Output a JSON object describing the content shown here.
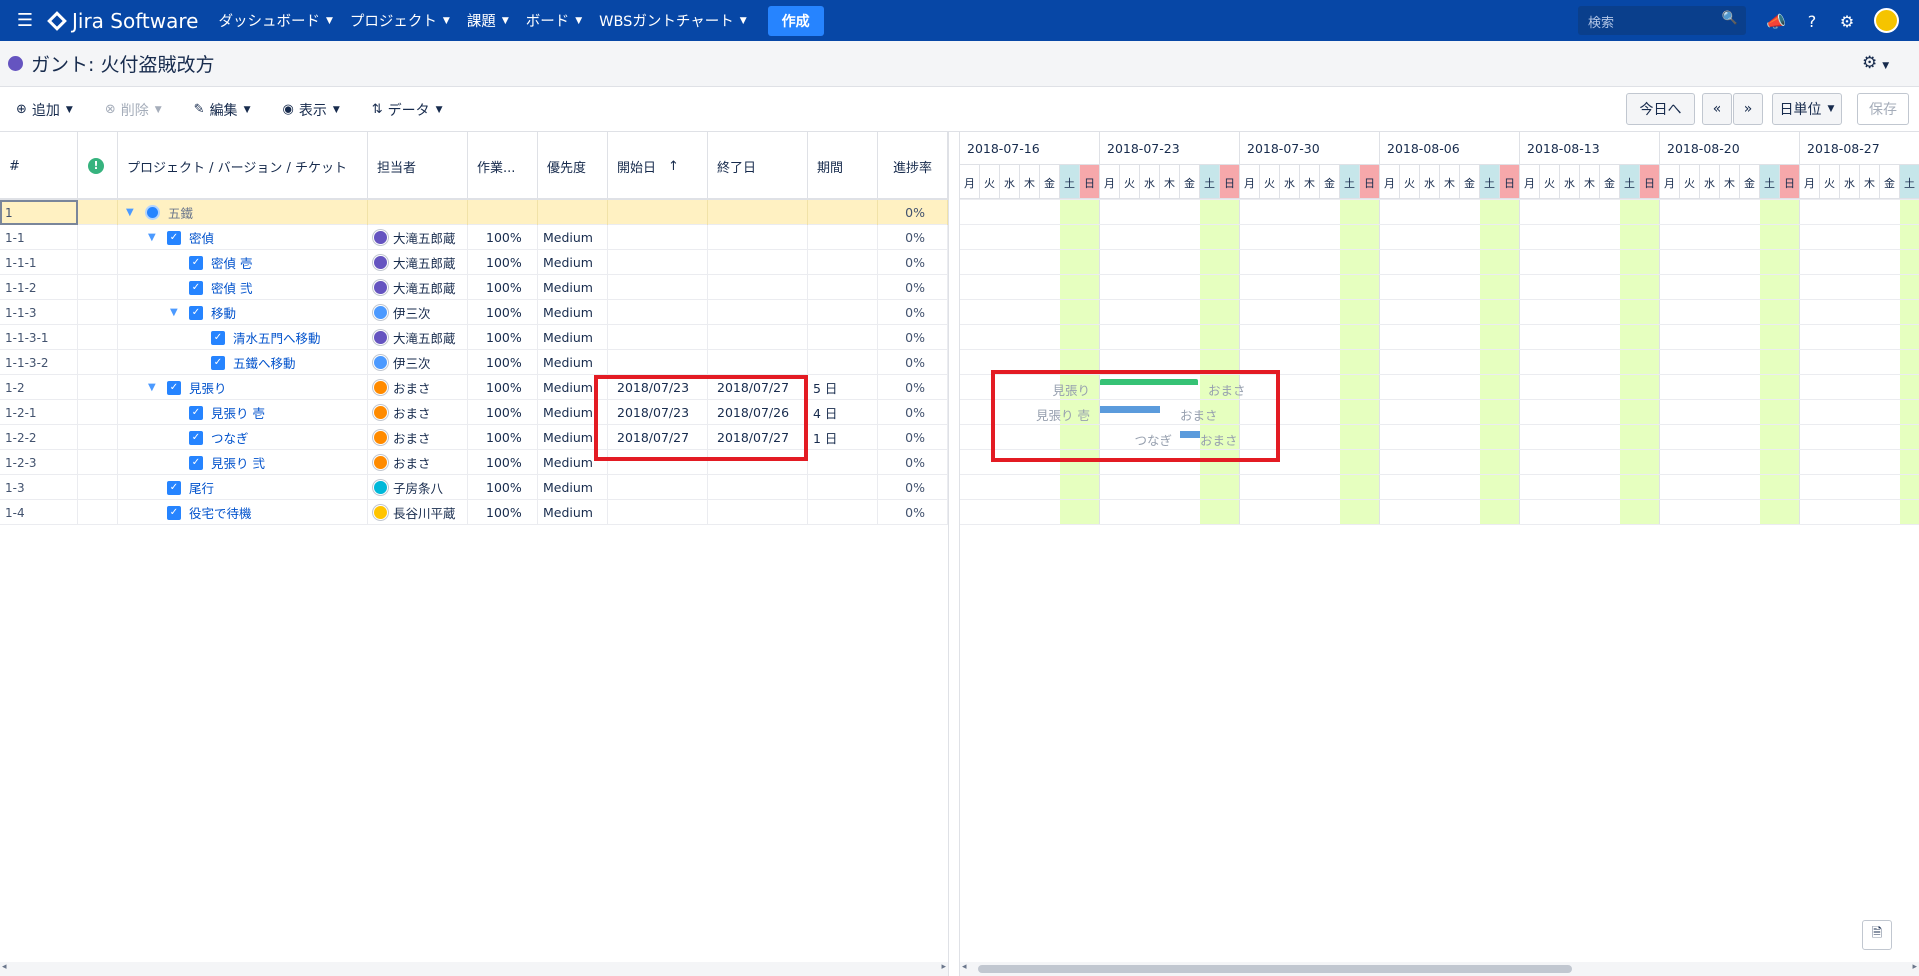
{
  "nav": {
    "logo": "Jira Software",
    "items": [
      {
        "label": "ダッシュボード"
      },
      {
        "label": "プロジェクト"
      },
      {
        "label": "課題"
      },
      {
        "label": "ボード"
      },
      {
        "label": "WBSガントチャート"
      }
    ],
    "create": "作成",
    "search_placeholder": "検索"
  },
  "page": {
    "title": "ガント: 火付盗賊改方"
  },
  "toolbar": {
    "add": "追加",
    "delete": "削除",
    "edit": "編集",
    "view": "表示",
    "data": "データ",
    "today": "今日へ",
    "prev": "«",
    "next": "»",
    "unit": "日単位",
    "save": "保存"
  },
  "grid": {
    "columns": {
      "num": "#",
      "name": "プロジェクト / バージョン / チケット",
      "assignee": "担当者",
      "work": "作業...",
      "priority": "優先度",
      "start": "開始日",
      "start_sort": "↑",
      "end": "終了日",
      "duration": "期間",
      "progress": "進捗率"
    },
    "rows": [
      {
        "id": "1",
        "name": "五鐵",
        "assignee": "",
        "work": "",
        "priority": "",
        "start": "",
        "end": "",
        "duration": "",
        "progress": "0%"
      },
      {
        "id": "1-1",
        "name": "密偵",
        "assignee": "大滝五郎蔵",
        "work": "100%",
        "priority": "Medium",
        "start": "",
        "end": "",
        "duration": "",
        "progress": "0%"
      },
      {
        "id": "1-1-1",
        "name": "密偵 壱",
        "assignee": "大滝五郎蔵",
        "work": "100%",
        "priority": "Medium",
        "start": "",
        "end": "",
        "duration": "",
        "progress": "0%"
      },
      {
        "id": "1-1-2",
        "name": "密偵 弐",
        "assignee": "大滝五郎蔵",
        "work": "100%",
        "priority": "Medium",
        "start": "",
        "end": "",
        "duration": "",
        "progress": "0%"
      },
      {
        "id": "1-1-3",
        "name": "移動",
        "assignee": "伊三次",
        "work": "100%",
        "priority": "Medium",
        "start": "",
        "end": "",
        "duration": "",
        "progress": "0%"
      },
      {
        "id": "1-1-3-1",
        "name": "清水五門へ移動",
        "assignee": "大滝五郎蔵",
        "work": "100%",
        "priority": "Medium",
        "start": "",
        "end": "",
        "duration": "",
        "progress": "0%"
      },
      {
        "id": "1-1-3-2",
        "name": "五鐵へ移動",
        "assignee": "伊三次",
        "work": "100%",
        "priority": "Medium",
        "start": "",
        "end": "",
        "duration": "",
        "progress": "0%"
      },
      {
        "id": "1-2",
        "name": "見張り",
        "assignee": "おまさ",
        "work": "100%",
        "priority": "Medium",
        "start": "2018/07/23",
        "end": "2018/07/27",
        "duration": "5 日",
        "progress": "0%"
      },
      {
        "id": "1-2-1",
        "name": "見張り 壱",
        "assignee": "おまさ",
        "work": "100%",
        "priority": "Medium",
        "start": "2018/07/23",
        "end": "2018/07/26",
        "duration": "4 日",
        "progress": "0%"
      },
      {
        "id": "1-2-2",
        "name": "つなぎ",
        "assignee": "おまさ",
        "work": "100%",
        "priority": "Medium",
        "start": "2018/07/27",
        "end": "2018/07/27",
        "duration": "1 日",
        "progress": "0%"
      },
      {
        "id": "1-2-3",
        "name": "見張り 弐",
        "assignee": "おまさ",
        "work": "100%",
        "priority": "Medium",
        "start": "",
        "end": "",
        "duration": "",
        "progress": "0%"
      },
      {
        "id": "1-3",
        "name": "尾行",
        "assignee": "子房条八",
        "work": "100%",
        "priority": "Medium",
        "start": "",
        "end": "",
        "duration": "",
        "progress": "0%"
      },
      {
        "id": "1-4",
        "name": "役宅で待機",
        "assignee": "長谷川平蔵",
        "work": "100%",
        "priority": "Medium",
        "start": "",
        "end": "",
        "duration": "",
        "progress": "0%"
      }
    ]
  },
  "gantt": {
    "weeks": [
      "2018-07-16",
      "2018-07-23",
      "2018-07-30",
      "2018-08-06",
      "2018-08-13",
      "2018-08-20",
      "2018-08-27"
    ],
    "days": [
      "月",
      "火",
      "水",
      "木",
      "金",
      "土",
      "日"
    ],
    "bars": [
      {
        "label_left": "見張り",
        "label_right": "おまさ"
      },
      {
        "label_left": "見張り 壱",
        "label_right": "おまさ"
      },
      {
        "label_left": "つなぎ",
        "label_right": "おまさ"
      }
    ]
  },
  "colors": {
    "nav_bg": "#0747a6",
    "accent": "#2684ff",
    "weekend": "#e6ffbf",
    "sat": "#c6e6ea",
    "sun": "#f6a8ab",
    "highlight": "#e31b23"
  }
}
